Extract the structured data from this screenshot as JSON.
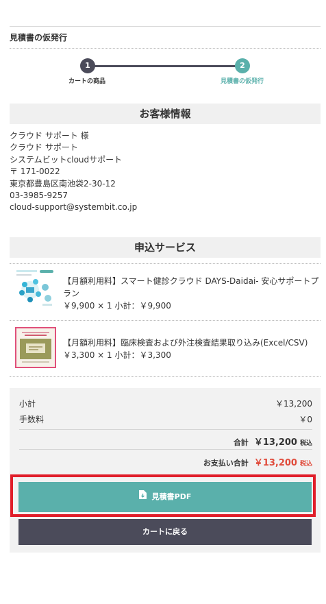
{
  "page": {
    "title": "見積書の仮発行"
  },
  "stepper": {
    "steps": [
      {
        "number": "1",
        "label": "カートの商品"
      },
      {
        "number": "2",
        "label": "見積書の仮発行"
      }
    ]
  },
  "customer": {
    "heading": "お客様情報",
    "name": "クラウド サポート 様",
    "contact": "クラウド サポート",
    "company": "システムビットcloudサポート",
    "postal": "〒 171-0022",
    "address": "東京都豊島区南池袋2-30-12",
    "phone": "03-3985-9257",
    "email": "cloud-support@systembit.co.jp"
  },
  "services": {
    "heading": "申込サービス",
    "items": [
      {
        "name": "【月額利用料】スマート健診クラウド DAYS-Daidai- 安心サポートプラン",
        "price_line": "￥9,900 × 1 小計：￥9,900"
      },
      {
        "name": "【月額利用料】臨床検査および外注検査結果取り込み(Excel/CSV)",
        "price_line": "￥3,300 × 1 小計：￥3,300"
      }
    ]
  },
  "summary": {
    "subtotal_label": "小計",
    "subtotal_value": "￥13,200",
    "fee_label": "手数料",
    "fee_value": "￥0",
    "total_label": "合計",
    "total_value": "￥13,200",
    "total_tax": "税込",
    "pay_label": "お支払い合計",
    "pay_value": "￥13,200",
    "pay_tax": "税込"
  },
  "buttons": {
    "pdf_label": "見積書PDF",
    "back_label": "カートに戻る"
  },
  "colors": {
    "accent": "#5ab0ab",
    "dark": "#4b4b5a",
    "price_red": "#e04a3a",
    "highlight": "#e01e2a"
  }
}
